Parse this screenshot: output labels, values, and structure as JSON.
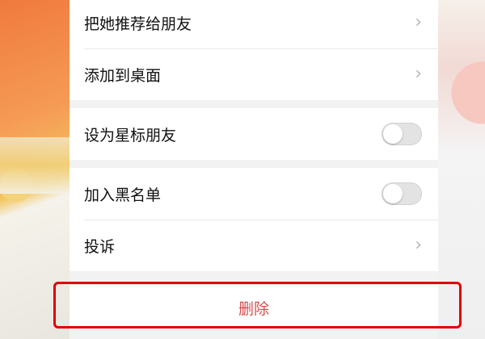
{
  "menu": {
    "recommend_label": "把她推荐给朋友",
    "add_desktop_label": "添加到桌面",
    "star_friend_label": "设为星标朋友",
    "blacklist_label": "加入黑名单",
    "report_label": "投诉",
    "delete_label": "删除"
  },
  "toggles": {
    "star_friend_on": false,
    "blacklist_on": false
  },
  "colors": {
    "delete_text": "#d84c4c",
    "highlight_border": "#e00000"
  }
}
